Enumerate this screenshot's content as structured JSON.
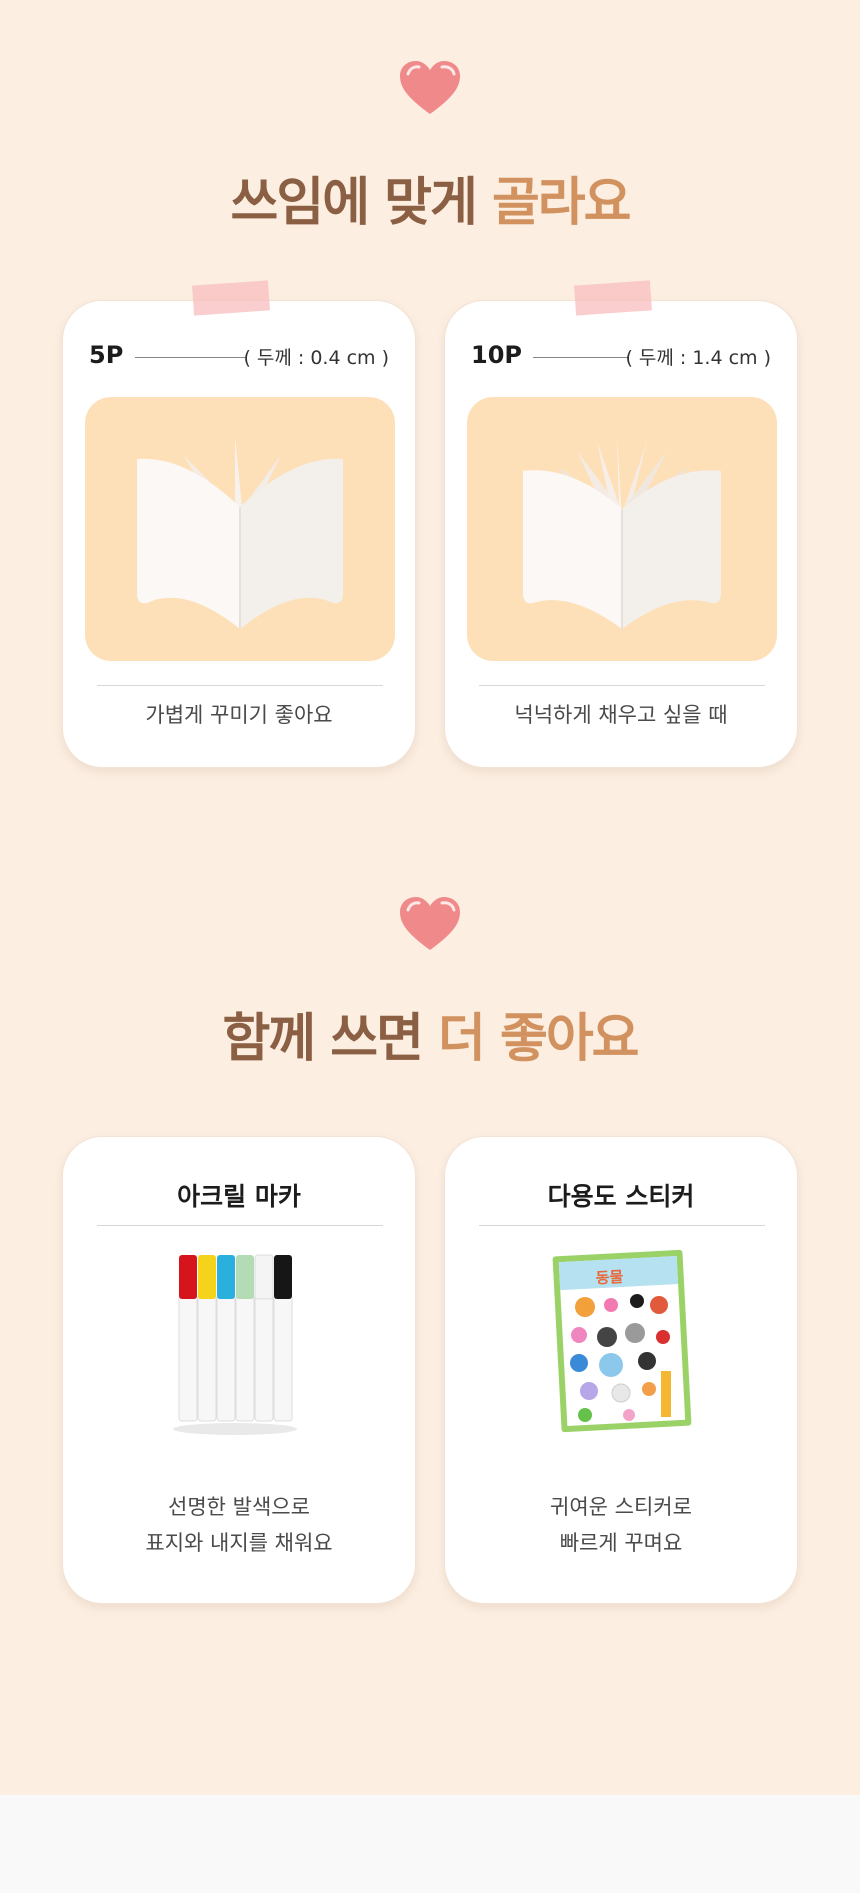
{
  "section1": {
    "heading_main": "쓰임에 맞게 ",
    "heading_accent": "골라요",
    "cards": [
      {
        "size": "5P",
        "thickness": "( 두께 : 0.4 cm )",
        "caption": "가볍게 꾸미기 좋아요"
      },
      {
        "size": "10P",
        "thickness": "( 두께 : 1.4 cm )",
        "caption": "넉넉하게 채우고 싶을 때"
      }
    ]
  },
  "section2": {
    "heading_main": "함께 쓰면 ",
    "heading_accent": "더 좋아요",
    "cards": [
      {
        "title": "아크릴 마카",
        "caption_line1": "선명한 발색으로",
        "caption_line2": "표지와 내지를 채워요"
      },
      {
        "title": "다용도 스티커",
        "caption_line1": "귀여운 스티커로",
        "caption_line2": "빠르게 꾸며요"
      }
    ],
    "sticker_sheet_title": "동물"
  },
  "colors": {
    "background": "#fcefe2",
    "heading_brown": "#8a5f43",
    "heading_accent": "#d2925f",
    "image_box": "#fee0b8",
    "heart": "#f08a8a"
  },
  "icons": [
    "heart-icon",
    "open-book-icon",
    "marker-set-icon",
    "sticker-sheet-icon"
  ]
}
